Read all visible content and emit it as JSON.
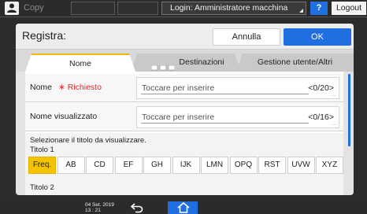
{
  "topbar": {
    "app_label": "Copy",
    "login_label": "Login: Amministratore macchina",
    "help_label": "?",
    "logout_label": "Logout",
    "mode_icon": "moon-icon"
  },
  "dialog": {
    "title": "Registra:",
    "cancel_label": "Annulla",
    "ok_label": "OK",
    "accent_color": "#1f6fe0"
  },
  "tabs": [
    {
      "label": "Nome",
      "active": true
    },
    {
      "label": "Destinazioni",
      "active": false
    },
    {
      "label": "Gestione utente/Altri",
      "active": false
    }
  ],
  "fields": {
    "name": {
      "label": "Nome",
      "required_label": "∗ Richiesto",
      "placeholder": "Toccare per inserire",
      "counter": "<0/20>"
    },
    "display_name": {
      "label": "Nome visualizzato",
      "placeholder": "Toccare per inserire",
      "counter": "<0/16>"
    }
  },
  "title_section": {
    "hint": "Selezionare il titolo da visualizzare.",
    "title1_label": "Titolo 1",
    "title2_label": "Titolo 2",
    "keys": [
      "Freq.",
      "AB",
      "CD",
      "EF",
      "GH",
      "IJK",
      "LMN",
      "OPQ",
      "RST",
      "UVW",
      "XYZ"
    ],
    "active_key": "Freq."
  },
  "bottombar": {
    "date": "04 Set. 2019",
    "time": "13 : 21"
  }
}
